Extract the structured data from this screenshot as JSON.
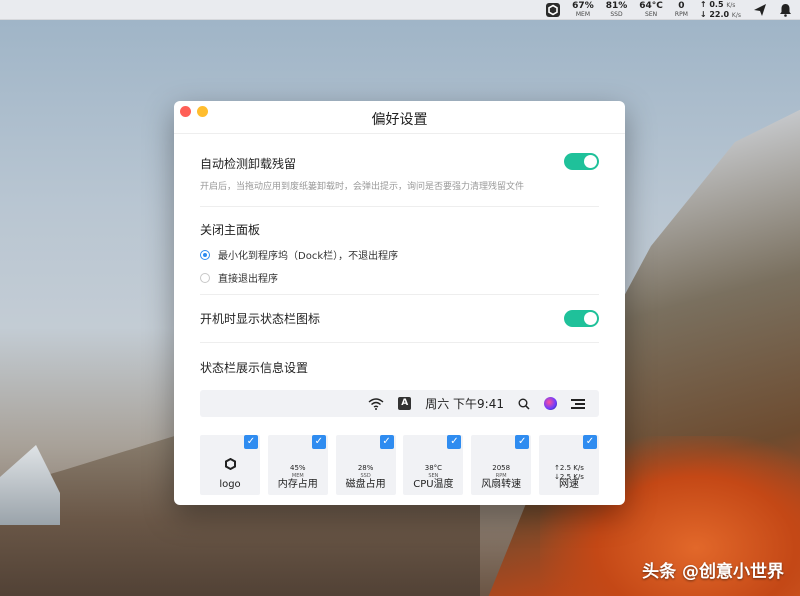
{
  "menubar": {
    "stats": [
      {
        "value": "67%",
        "label": "MEM"
      },
      {
        "value": "81%",
        "label": "SSD"
      },
      {
        "value": "64°C",
        "label": "SEN"
      },
      {
        "value": "0",
        "label": "RPM"
      }
    ],
    "net_up": "↑ 0.5",
    "net_up_unit": "K/s",
    "net_down": "↓ 22.0",
    "net_down_unit": "K/s",
    "icons": [
      "app-logo-icon",
      "send-icon",
      "bell-icon"
    ]
  },
  "window": {
    "title": "偏好设置",
    "auto_detect": {
      "title": "自动检测卸载残留",
      "description": "开启后，当拖动应用到废纸篓卸载时，会弹出提示，询问是否要强力清理残留文件",
      "enabled": true
    },
    "close_panel": {
      "title": "关闭主面板",
      "options": [
        {
          "label": "最小化到程序坞（Dock栏），不退出程序",
          "selected": true
        },
        {
          "label": "直接退出程序",
          "selected": false
        }
      ]
    },
    "startup": {
      "title": "开机时显示状态栏图标",
      "enabled": true
    },
    "statusbar": {
      "title": "状态栏展示信息设置",
      "preview": {
        "input_source": "A",
        "time": "周六 下午9:41"
      },
      "tiles": [
        {
          "label": "logo",
          "checked": true,
          "preview_value": "",
          "preview_label": ""
        },
        {
          "label": "内存占用",
          "checked": true,
          "preview_value": "45%",
          "preview_label": "MEM"
        },
        {
          "label": "磁盘占用",
          "checked": true,
          "preview_value": "28%",
          "preview_label": "SSD"
        },
        {
          "label": "CPU温度",
          "checked": true,
          "preview_value": "38°C",
          "preview_label": "SEN"
        },
        {
          "label": "风扇转速",
          "checked": true,
          "preview_value": "2058",
          "preview_label": "RPM"
        },
        {
          "label": "网速",
          "checked": true,
          "preview_value": "↑2.5 K/s",
          "preview_label": "↓2.5 K/s"
        }
      ]
    }
  },
  "watermark": "头条 @创意小世界",
  "colors": {
    "toggle_on": "#1fc19a",
    "accent": "#2f8cf0",
    "close": "#ff5f57",
    "minimize": "#ffbd2e"
  }
}
